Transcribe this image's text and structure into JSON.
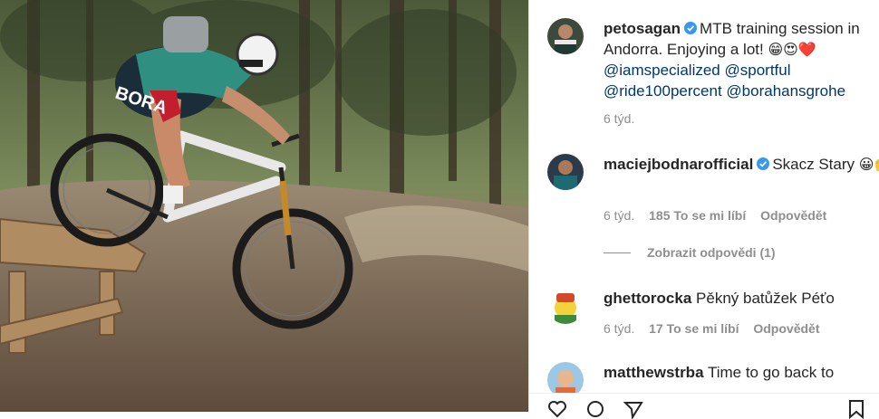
{
  "post": {
    "author": "petosagan",
    "caption_text": "MTB training session in Andorra. Enjoying a lot!",
    "caption_emojis": "😁😍❤️",
    "mentions": [
      "@iamspecialized",
      "@sportful",
      "@ride100percent",
      "@borahansgrohe"
    ],
    "time": "6 týd."
  },
  "comments": [
    {
      "user": "maciejbodnarofficial",
      "verified": true,
      "text": "Skacz Stary",
      "emojis": "😀🙌",
      "time": "6 týd.",
      "likes": "185 To se mi líbí",
      "reply_label": "Odpovědět",
      "view_replies": "Zobrazit odpovědi (1)"
    },
    {
      "user": "ghettorocka",
      "verified": false,
      "text": "Pěkný batůžek Péťo",
      "time": "6 týd.",
      "likes": "17 To se mi líbí",
      "reply_label": "Odpovědět"
    },
    {
      "user": "matthewstrba",
      "verified": false,
      "text": "Time to go back to"
    }
  ],
  "photo": {
    "jersey_text": "BORA",
    "icon": "mtb-rider-photo"
  },
  "colors": {
    "verified": "#3897f0",
    "mention": "#00376b",
    "secondary_text": "#8e8e8e",
    "heart": "#ed4956"
  }
}
